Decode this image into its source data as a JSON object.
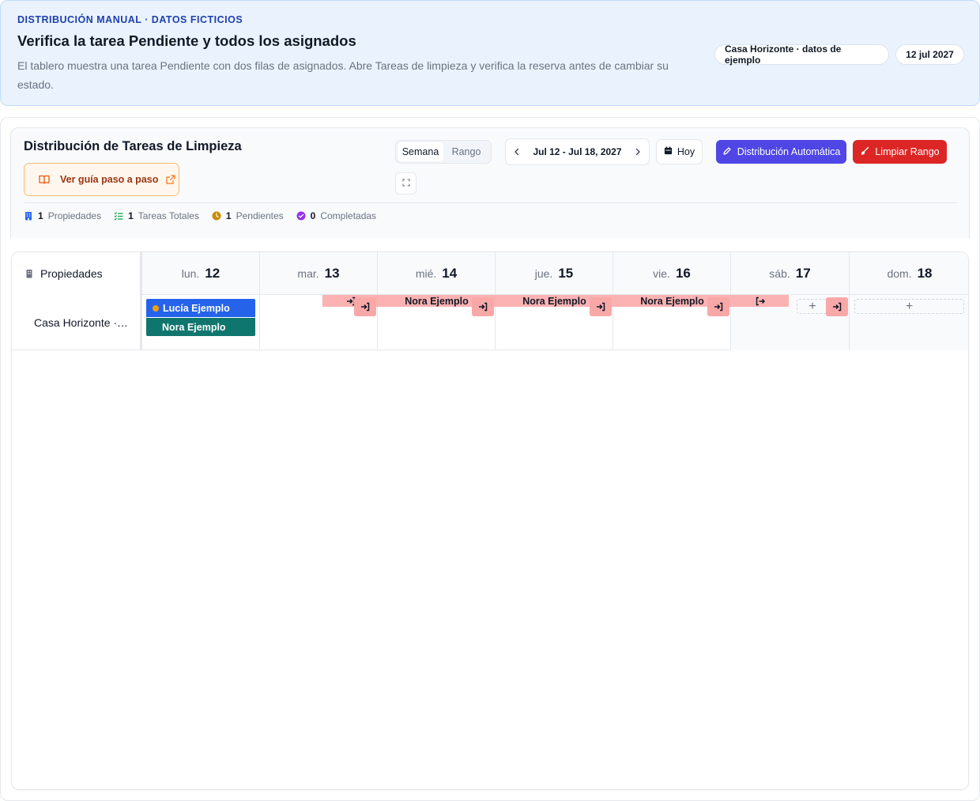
{
  "banner": {
    "eyebrow": "DISTRIBUCIÓN MANUAL · DATOS FICTICIOS",
    "title": "Verifica la tarea Pendiente y todos los asignados",
    "description": "El tablero muestra una tarea Pendiente con dos filas de asignados. Abre Tareas de limpieza y verifica la reserva antes de cambiar su estado.",
    "property_pill": "Casa Horizonte · datos de ejemplo",
    "date_pill": "12 jul 2027"
  },
  "toolbar": {
    "title": "Distribución de Tareas de Limpieza",
    "guide_label": "Ver guía paso a paso",
    "view_options": [
      "Semana",
      "Rango"
    ],
    "active_view": "Semana",
    "range_label": "Jul 12 - Jul 18, 2027",
    "today_label": "Hoy",
    "auto_label": "Distribución Automática",
    "clear_label": "Limpiar Rango"
  },
  "stats": [
    {
      "value": "1",
      "label": "Propiedades",
      "icon": "building-icon",
      "color": "#2563eb"
    },
    {
      "value": "1",
      "label": "Tareas Totales",
      "icon": "list-check-icon",
      "color": "#16a34a"
    },
    {
      "value": "1",
      "label": "Pendientes",
      "icon": "clock-icon",
      "color": "#ca8a04"
    },
    {
      "value": "0",
      "label": "Completadas",
      "icon": "check-circle-icon",
      "color": "#9333ea"
    }
  ],
  "grid": {
    "properties_header": "Propiedades",
    "days": [
      {
        "weekday": "lun.",
        "day": "12"
      },
      {
        "weekday": "mar.",
        "day": "13"
      },
      {
        "weekday": "mié.",
        "day": "14"
      },
      {
        "weekday": "jue.",
        "day": "15"
      },
      {
        "weekday": "vie.",
        "day": "16"
      },
      {
        "weekday": "sáb.",
        "day": "17"
      },
      {
        "weekday": "dom.",
        "day": "18"
      }
    ],
    "rows": [
      {
        "property": "Casa Horizonte ·…",
        "tasks": [
          {
            "assignee": "Lucía Ejemplo",
            "status": "Pendiente",
            "color": "#2563eb"
          },
          {
            "assignee": "Nora Ejemplo",
            "color": "#0f766e"
          }
        ],
        "booking_labels": [
          "Nora Ejemplo",
          "Nora Ejemplo",
          "Nora Ejemplo"
        ],
        "add_symbol": "+"
      }
    ]
  },
  "colors": {
    "accent": "#4f46e5",
    "danger": "#dc2626",
    "booking": "#fca5a5"
  }
}
